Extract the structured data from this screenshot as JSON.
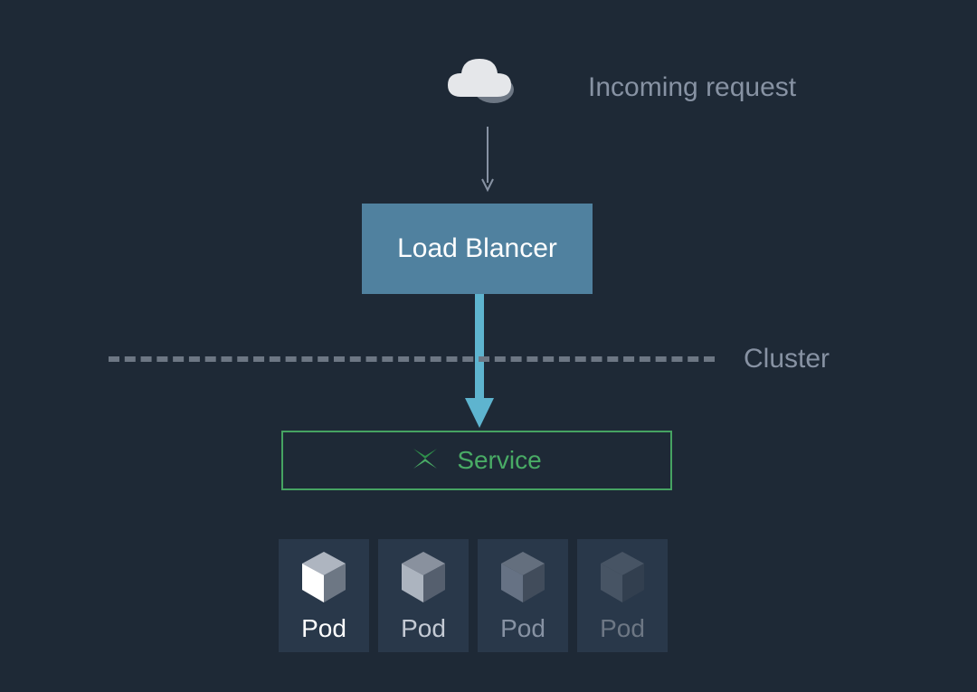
{
  "incoming_label": "Incoming request",
  "load_balancer_label": "Load Blancer",
  "cluster_label": "Cluster",
  "service_label": "Service",
  "colors": {
    "background": "#1e2936",
    "muted_text": "#8792a3",
    "lb_box": "#50819f",
    "lb_text": "#ffffff",
    "arrow": "#5eb4cf",
    "service_border": "#46a362",
    "service_text": "#49ab65",
    "pod_bg": "#29384a",
    "pod_active_text": "#ffffff",
    "pod_inactive_text": "#8792a3"
  },
  "pods": [
    {
      "label": "Pod",
      "opacity": 1.0,
      "labelColor": "#ffffff",
      "frontFace": "#ffffff"
    },
    {
      "label": "Pod",
      "opacity": 0.85,
      "labelColor": "#c4cad4",
      "frontFace": "#c4cad4"
    },
    {
      "label": "Pod",
      "opacity": 0.65,
      "labelColor": "#8792a3",
      "frontFace": "#8792a3"
    },
    {
      "label": "Pod",
      "opacity": 0.45,
      "labelColor": "#6d7784",
      "frontFace": "#6d7784"
    }
  ]
}
